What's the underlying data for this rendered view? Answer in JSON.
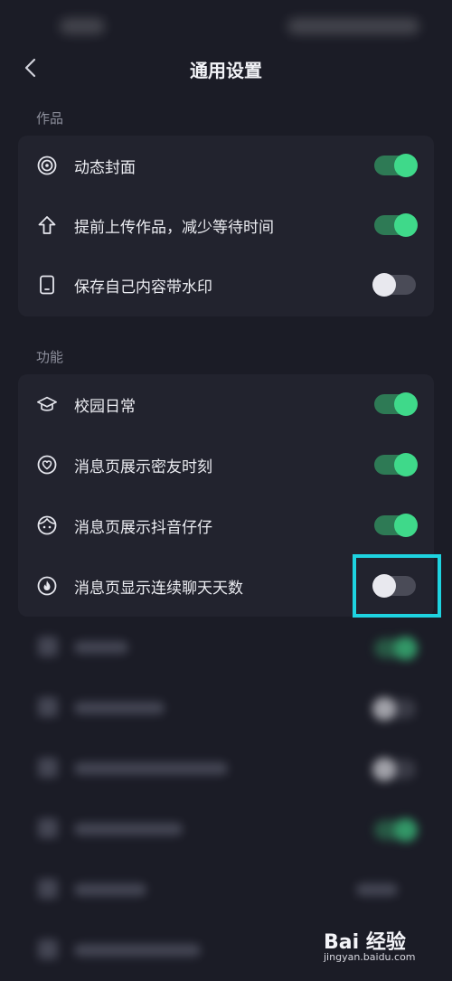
{
  "header": {
    "title": "通用设置"
  },
  "sections": [
    {
      "label": "作品",
      "items": [
        {
          "label": "动态封面",
          "icon": "dynamic-cover-icon",
          "on": true
        },
        {
          "label": "提前上传作品，减少等待时间",
          "icon": "upload-arrow-icon",
          "on": true
        },
        {
          "label": "保存自己内容带水印",
          "icon": "phone-icon",
          "on": false
        }
      ]
    },
    {
      "label": "功能",
      "items": [
        {
          "label": "校园日常",
          "icon": "graduation-cap-icon",
          "on": true
        },
        {
          "label": "消息页展示密友时刻",
          "icon": "heart-circle-icon",
          "on": true
        },
        {
          "label": "消息页展示抖音仔仔",
          "icon": "avatar-face-icon",
          "on": true
        },
        {
          "label": "消息页显示连续聊天天数",
          "icon": "flame-icon",
          "on": false
        }
      ]
    }
  ],
  "colors": {
    "background": "#1b1c26",
    "card": "#22232e",
    "toggle_on": "#3fd98a",
    "highlight": "#1ed3e0"
  },
  "watermark": {
    "brand": "Bai 经验",
    "url": "jingyan.baidu.com"
  }
}
